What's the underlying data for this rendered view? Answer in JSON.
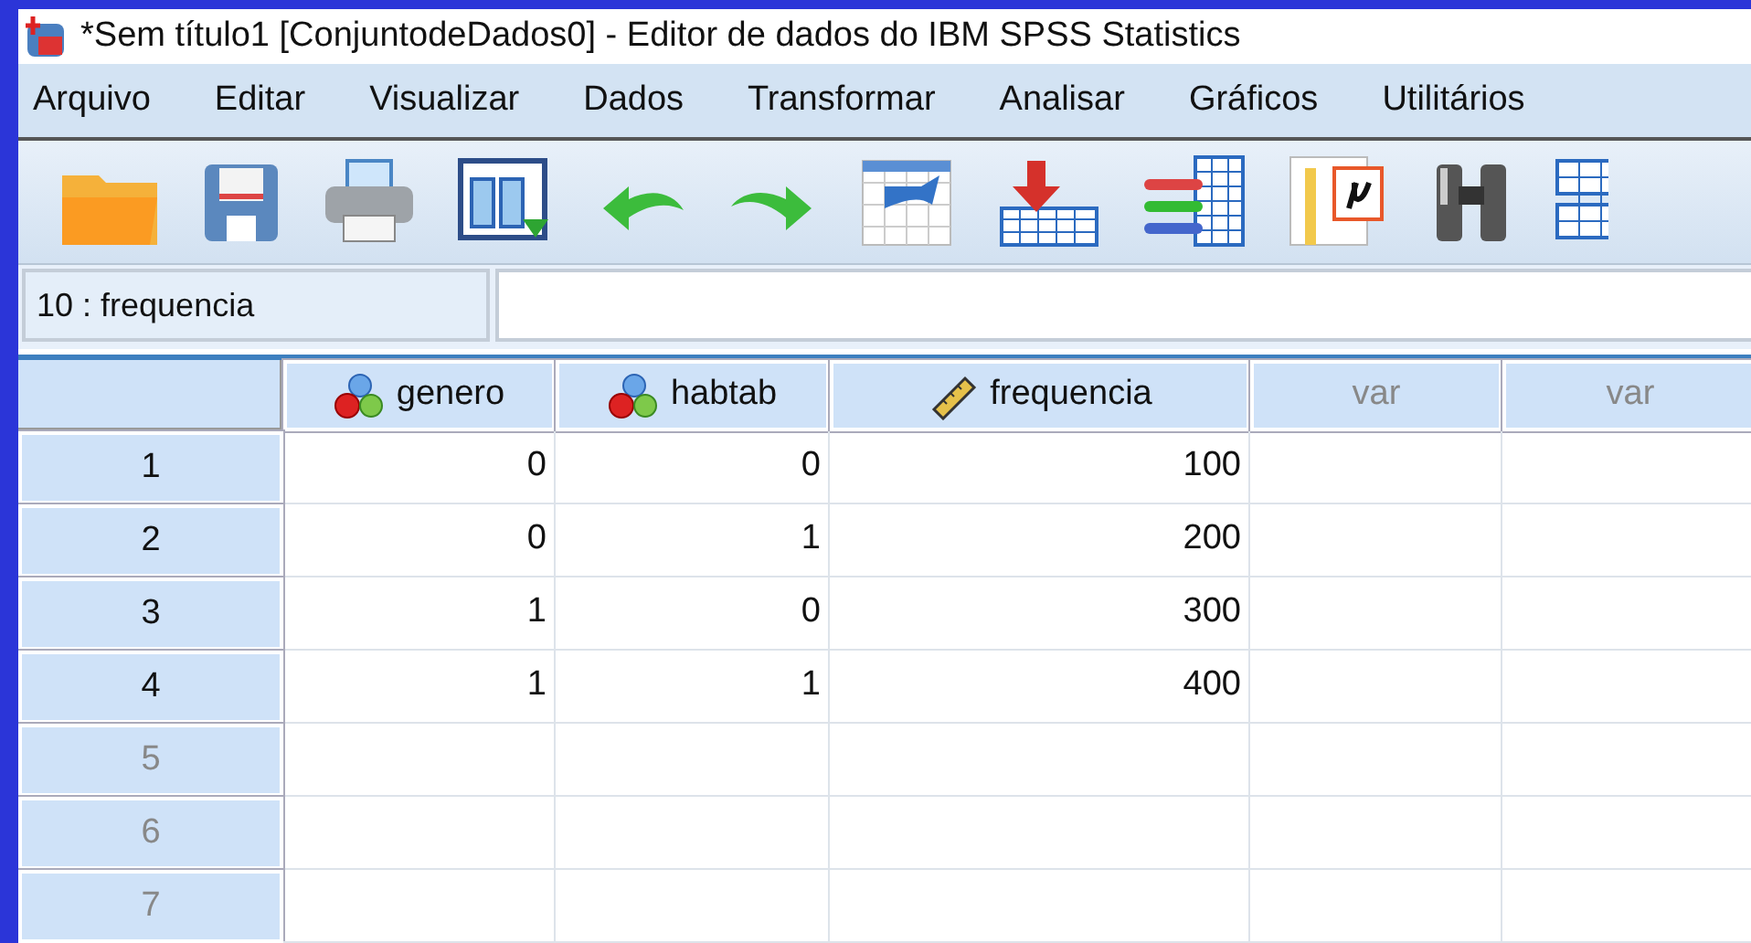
{
  "window": {
    "title": "*Sem título1 [ConjuntodeDados0] - Editor de dados do IBM SPSS Statistics"
  },
  "menu": [
    {
      "label": "Arquivo"
    },
    {
      "label": "Editar"
    },
    {
      "label": "Visualizar"
    },
    {
      "label": "Dados"
    },
    {
      "label": "Transformar"
    },
    {
      "label": "Analisar"
    },
    {
      "label": "Gráficos"
    },
    {
      "label": "Utilitários"
    }
  ],
  "cell_reference": {
    "value": "10 : frequencia"
  },
  "table": {
    "columns": [
      {
        "label": "genero",
        "kind": "nominal"
      },
      {
        "label": "habtab",
        "kind": "nominal"
      },
      {
        "label": "frequencia",
        "kind": "scale"
      },
      {
        "label": "var",
        "kind": "empty"
      },
      {
        "label": "var",
        "kind": "empty"
      }
    ],
    "rows": [
      {
        "number": "1",
        "empty": false,
        "cells": [
          "0",
          "0",
          "100"
        ]
      },
      {
        "number": "2",
        "empty": false,
        "cells": [
          "0",
          "1",
          "200"
        ]
      },
      {
        "number": "3",
        "empty": false,
        "cells": [
          "1",
          "0",
          "300"
        ]
      },
      {
        "number": "4",
        "empty": false,
        "cells": [
          "1",
          "1",
          "400"
        ]
      },
      {
        "number": "5",
        "empty": true
      },
      {
        "number": "6",
        "empty": true
      },
      {
        "number": "7",
        "empty": true
      }
    ]
  }
}
